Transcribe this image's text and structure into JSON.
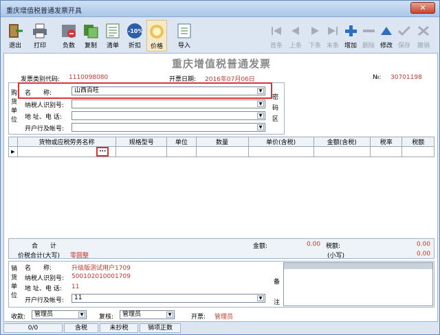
{
  "window": {
    "title": "重庆增值税普通发票开具",
    "close_label": "✕"
  },
  "toolbar": {
    "left": [
      {
        "label": "退出",
        "icon": "exit-icon"
      },
      {
        "label": "打印",
        "icon": "printer-icon"
      },
      {
        "label": "负数",
        "icon": "negative-icon"
      },
      {
        "label": "复制",
        "icon": "copy-icon"
      },
      {
        "label": "清单",
        "icon": "list-icon"
      },
      {
        "label": "折扣",
        "icon": "discount-icon"
      },
      {
        "label": "价格",
        "icon": "price-icon"
      },
      {
        "label": "导入",
        "icon": "import-icon"
      }
    ],
    "right": [
      {
        "label": "首条",
        "icon": "first-icon",
        "disabled": true
      },
      {
        "label": "上条",
        "icon": "prev-icon",
        "disabled": true
      },
      {
        "label": "下条",
        "icon": "next-icon",
        "disabled": true
      },
      {
        "label": "末条",
        "icon": "last-icon",
        "disabled": true
      },
      {
        "label": "增加",
        "icon": "add-icon",
        "disabled": false
      },
      {
        "label": "删除",
        "icon": "delete-icon",
        "disabled": true
      },
      {
        "label": "修改",
        "icon": "edit-icon",
        "disabled": false
      },
      {
        "label": "保存",
        "icon": "save-icon",
        "disabled": true
      },
      {
        "label": "撤销",
        "icon": "undo-icon",
        "disabled": true
      }
    ],
    "discount_badge": "-10%"
  },
  "invoice": {
    "title": "重庆增值税普通发票",
    "code_label": "发票类别代码:",
    "code_value": "1110098080",
    "date_label": "开票日期:",
    "date_value": "2016年07月06日",
    "no_label": "№:",
    "no_value": "30701198"
  },
  "buyer": {
    "side_label": [
      "购",
      "货",
      "单",
      "位"
    ],
    "name_label": "名　　称:",
    "name_value": "山西百旺",
    "tax_label": "纳税人识别号:",
    "tax_value": "",
    "addr_label": "地 址、电 话:",
    "addr_value": "",
    "bank_label": "开户行及帐号:",
    "bank_value": "",
    "cipher_label": [
      "密",
      "码",
      "区"
    ]
  },
  "goods_table": {
    "headers": [
      "货物或应税劳务名称",
      "规格型号",
      "单位",
      "数量",
      "单价(含税)",
      "金额(含税)",
      "税率",
      "税额"
    ],
    "ellipsis": "···"
  },
  "totals": {
    "sum_label": "合　　计",
    "amount_label": "金额:",
    "amount_value": "0.00",
    "tax_label": "税额:",
    "tax_value": "0.00",
    "total_label": "价税合计(大写)",
    "total_words": "零圆整",
    "small_label": "(小写)",
    "small_value": "0.00"
  },
  "seller": {
    "side_label": [
      "销",
      "货",
      "单",
      "位"
    ],
    "name_label": "名　　称:",
    "name_value": "升级版测试用户1709",
    "tax_label": "纳税人识别号:",
    "tax_value": "500102010001709",
    "addr_label": "地 址、电 话:",
    "addr_value": "11",
    "bank_label": "开户行及帐号:",
    "bank_value": "11",
    "remark_label": [
      "备",
      "注"
    ]
  },
  "signers": {
    "payee_label": "收款:",
    "payee_value": "管理员",
    "checker_label": "复核:",
    "checker_value": "管理员",
    "issuer_label": "开票:",
    "issuer_value": "管理员"
  },
  "status": {
    "count": "0/0",
    "tax_mode": "含税",
    "copy_state": "未抄税",
    "receipt_type": "销项正数"
  },
  "colors": {
    "accent_red": "#d9333a",
    "value_red": "#c0392b",
    "title_gray": "#8a8a8a"
  }
}
